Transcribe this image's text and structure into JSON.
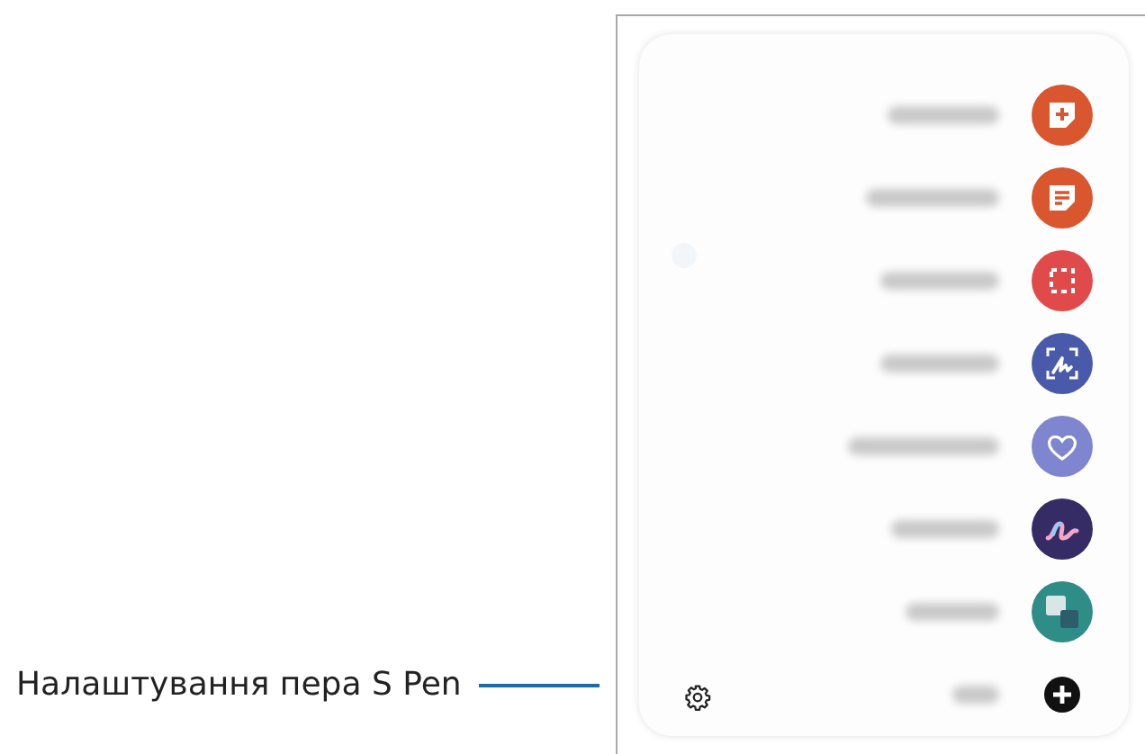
{
  "callout": {
    "label": "Налаштування пера S Pen"
  },
  "panel": {
    "items": [
      {
        "kind": "note-add"
      },
      {
        "kind": "note-list"
      },
      {
        "kind": "screen-select"
      },
      {
        "kind": "screen-write"
      },
      {
        "kind": "heart"
      },
      {
        "kind": "doodle"
      },
      {
        "kind": "app"
      },
      {
        "kind": "add"
      }
    ]
  }
}
